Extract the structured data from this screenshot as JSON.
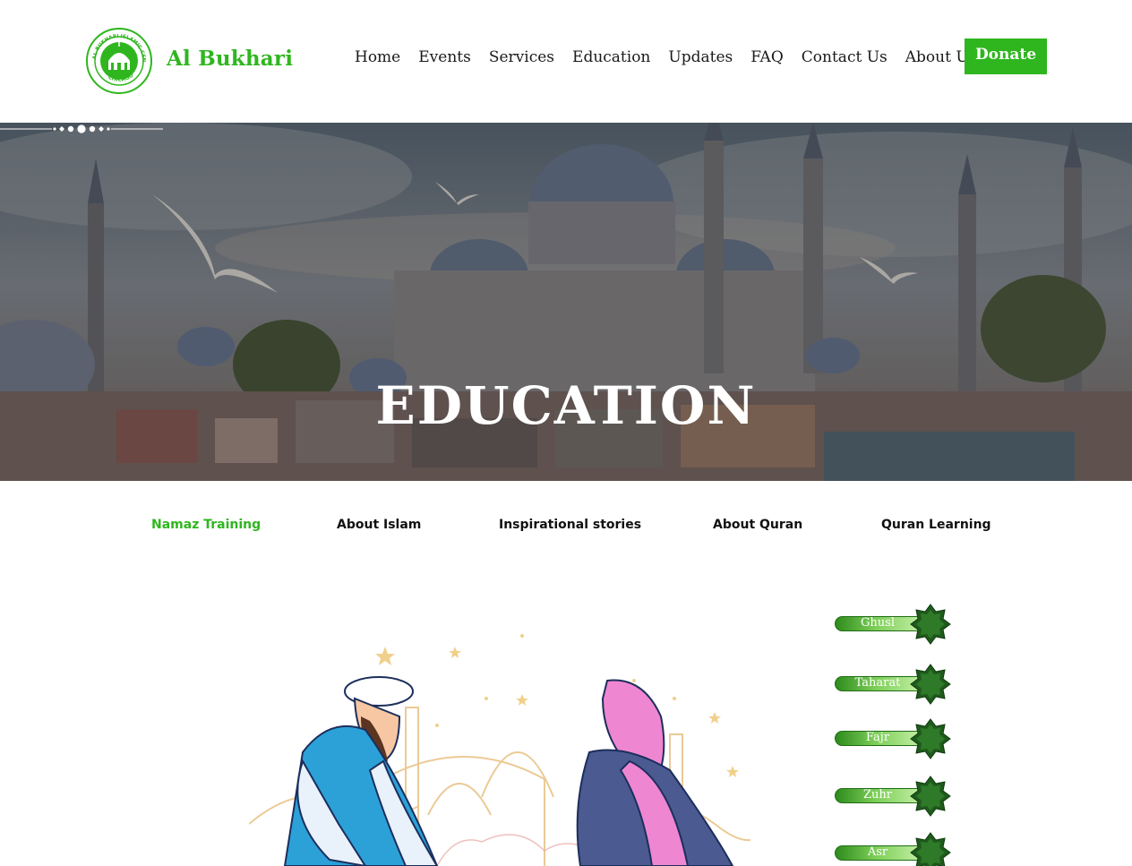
{
  "brand": {
    "name": "Al Bukhari",
    "logo_ring_text": "AL BUKHARI ISLAMIC CENTER",
    "logo_city": "CHICAGO"
  },
  "nav": {
    "items": [
      "Home",
      "Events",
      "Services",
      "Education",
      "Updates",
      "FAQ",
      "Contact Us",
      "About Us"
    ],
    "donate_label": "Donate"
  },
  "hero": {
    "title": "EDUCATION"
  },
  "tabs": {
    "items": [
      "Namaz Training",
      "About Islam",
      "Inspirational stories",
      "About Quran",
      "Quran Learning"
    ],
    "active": "Namaz Training"
  },
  "side_menu": {
    "items": [
      "Ghusl",
      "Taharat",
      "Fajr",
      "Zuhr",
      "Asr"
    ]
  },
  "colors": {
    "brand_green": "#2fb61f",
    "dark_green": "#1f5a1c"
  },
  "icons": {
    "logo": "mosque-dome-seal-icon",
    "ornament": "dots-divider-icon",
    "menu_marker": "eight-point-star-icon"
  }
}
